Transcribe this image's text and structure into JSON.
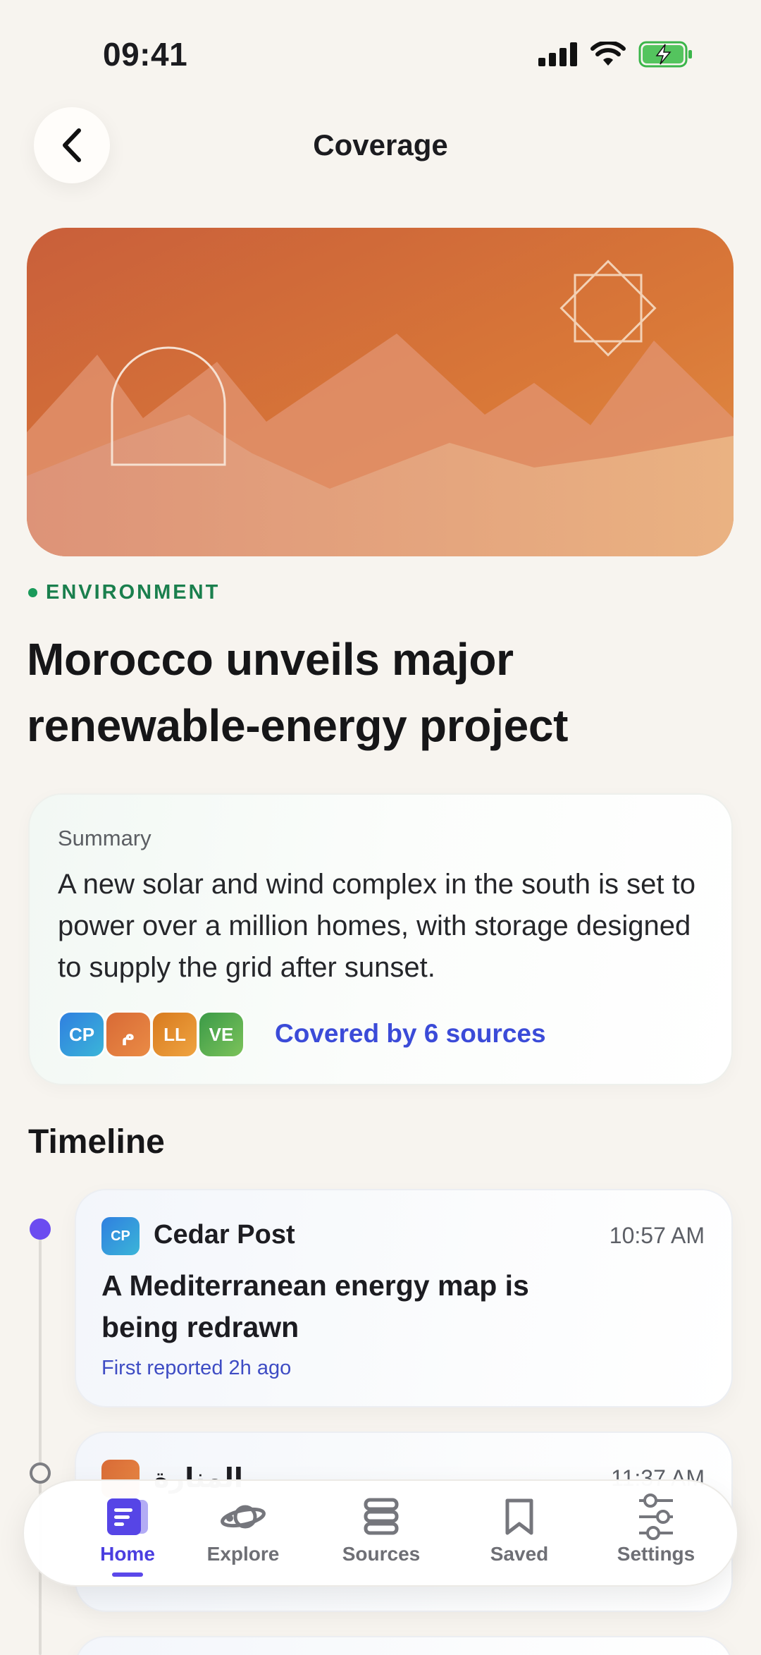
{
  "status_bar": {
    "time": "09:41"
  },
  "header": {
    "title": "Coverage"
  },
  "article": {
    "category": "ENVIRONMENT",
    "headline": "Morocco unveils major renewable-energy project"
  },
  "summary": {
    "label": "Summary",
    "text": "A new solar and wind complex in the south is set to power over a million homes, with storage designed to supply the grid after sunset.",
    "sources": [
      {
        "initials": "CP",
        "color": "#2b8fd8"
      },
      {
        "initials": "م",
        "color": "#e07a3a"
      },
      {
        "initials": "LL",
        "color": "#e2902c"
      },
      {
        "initials": "VE",
        "color": "#4caf50"
      }
    ],
    "covered_text": "Covered by 6 sources"
  },
  "timeline": {
    "title": "Timeline",
    "items": [
      {
        "source_initials": "CP",
        "source": "Cedar Post",
        "time": "10:57 AM",
        "headline": "A Mediterranean energy map is being redrawn",
        "meta": "First reported 2h ago"
      },
      {
        "source": "المنارة",
        "time": "11:37 AM"
      }
    ]
  },
  "tab_bar": {
    "tabs": [
      {
        "label": "Home",
        "icon": "home-doc-icon",
        "active": true
      },
      {
        "label": "Explore",
        "icon": "planet-icon"
      },
      {
        "label": "Sources",
        "icon": "stack-icon"
      },
      {
        "label": "Saved",
        "icon": "bookmark-icon"
      },
      {
        "label": "Settings",
        "icon": "sliders-icon"
      }
    ]
  },
  "colors": {
    "accent": "#4b3ee0",
    "category": "#1a7f4d",
    "link": "#3b4bd8",
    "background": "#f7f4ef"
  }
}
